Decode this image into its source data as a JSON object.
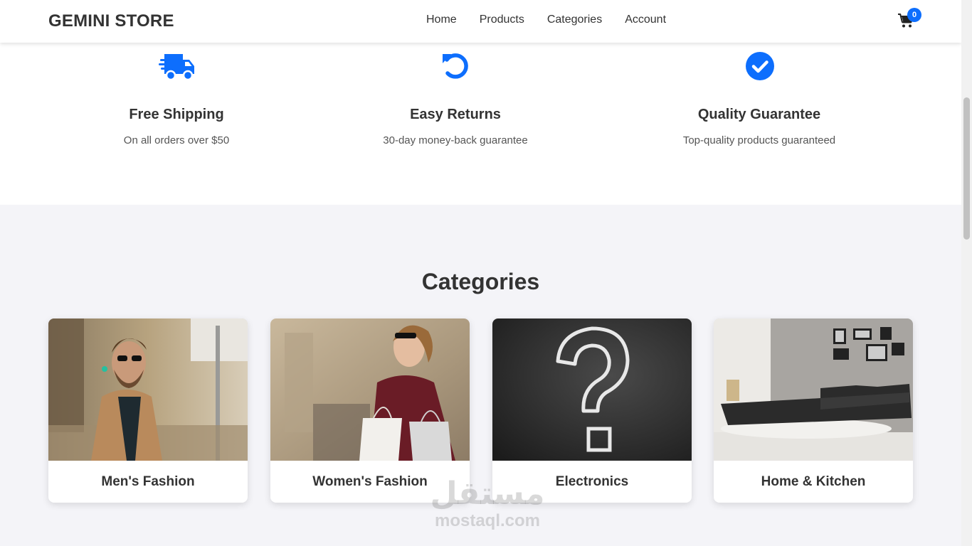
{
  "header": {
    "logo": "GEMINI STORE",
    "nav": [
      "Home",
      "Products",
      "Categories",
      "Account"
    ],
    "cart_icon": "cart-icon",
    "cart_count": "0"
  },
  "features": [
    {
      "icon": "truck-icon",
      "title": "Free Shipping",
      "text": "On all orders over $50"
    },
    {
      "icon": "undo-icon",
      "title": "Easy Returns",
      "text": "30-day money-back guarantee"
    },
    {
      "icon": "check-circle-icon",
      "title": "Quality Guarantee",
      "text": "Top-quality products guaranteed"
    }
  ],
  "categories": {
    "title": "Categories",
    "items": [
      {
        "label": "Men's Fashion"
      },
      {
        "label": "Women's Fashion"
      },
      {
        "label": "Electronics"
      },
      {
        "label": "Home & Kitchen"
      }
    ]
  },
  "watermark": {
    "arabic": "مستقل",
    "latin": "mostaql.com"
  },
  "colors": {
    "accent": "#0d6efd",
    "section_bg": "#f4f4f8",
    "text": "#333333"
  }
}
